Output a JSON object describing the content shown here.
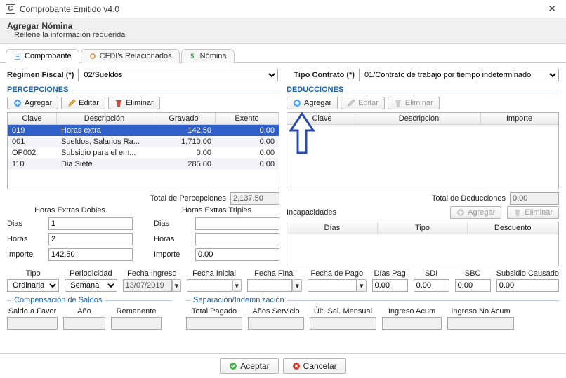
{
  "window": {
    "title": "Comprobante Emitido v4.0"
  },
  "subheader": {
    "title": "Agregar Nómina",
    "subtitle": "Rellene la información requerida"
  },
  "tabs": [
    {
      "label": "Comprobante"
    },
    {
      "label": "CFDI's Relacionados"
    },
    {
      "label": "Nómina"
    }
  ],
  "regimen": {
    "label": "Régimen Fiscal (*)",
    "value": "02/Sueldos"
  },
  "tipocontrato": {
    "label": "Tipo Contrato (*)",
    "value": "01/Contrato de trabajo por tiempo indeterminado"
  },
  "percepciones": {
    "title": "PERCEPCIONES",
    "buttons": {
      "add": "Agregar",
      "edit": "Editar",
      "del": "Eliminar"
    },
    "headers": {
      "clave": "Clave",
      "desc": "Descripción",
      "grav": "Gravado",
      "exen": "Exento"
    },
    "rows": [
      {
        "clave": "019",
        "desc": "Horas extra",
        "grav": "142.50",
        "exen": "0.00",
        "sel": true
      },
      {
        "clave": "001",
        "desc": "Sueldos, Salarios  Ra...",
        "grav": "1,710.00",
        "exen": "0.00"
      },
      {
        "clave": "OP002",
        "desc": "Subsidio para el em...",
        "grav": "0.00",
        "exen": "0.00"
      },
      {
        "clave": "110",
        "desc": "Dia Siete",
        "grav": "285.00",
        "exen": "0.00"
      }
    ],
    "total_label": "Total de Percepciones",
    "total_value": "2,137.50"
  },
  "deducciones": {
    "title": "DEDUCCIONES",
    "buttons": {
      "add": "Agregar",
      "edit": "Editar",
      "del": "Eliminar"
    },
    "headers": {
      "clave": "Clave",
      "desc": "Descripción",
      "imp": "Importe"
    },
    "total_label": "Total de Deducciones",
    "total_value": "0.00"
  },
  "horas_dobles": {
    "title": "Horas Extras Dobles",
    "dias_label": "Dias",
    "dias_value": "1",
    "horas_label": "Horas",
    "horas_value": "2",
    "importe_label": "Importe",
    "importe_value": "142.50"
  },
  "horas_triples": {
    "title": "Horas Extras Triples",
    "dias_label": "Dias",
    "dias_value": "",
    "horas_label": "Horas",
    "horas_value": "",
    "importe_label": "Importe",
    "importe_value": "0.00"
  },
  "incapacidades": {
    "label": "Incapacidades",
    "buttons": {
      "add": "Agregar",
      "del": "Eliminar"
    },
    "headers": {
      "dias": "Días",
      "tipo": "Tipo",
      "desc": "Descuento"
    }
  },
  "meta_fields": {
    "tipo": {
      "label": "Tipo",
      "value": "Ordinaria"
    },
    "periodicidad": {
      "label": "Periodicidad",
      "value": "Semanal"
    },
    "fecha_ingreso": {
      "label": "Fecha Ingreso",
      "value": "13/07/2019"
    },
    "fecha_inicial": {
      "label": "Fecha Inicial",
      "value": ""
    },
    "fecha_final": {
      "label": "Fecha Final",
      "value": ""
    },
    "fecha_pago": {
      "label": "Fecha de Pago",
      "value": ""
    },
    "dias_pag": {
      "label": "Días Pag",
      "value": "0.00"
    },
    "sdi": {
      "label": "SDI",
      "value": "0.00"
    },
    "sbc": {
      "label": "SBC",
      "value": "0.00"
    },
    "subsidio": {
      "label": "Subsidio Causado",
      "value": "0.00"
    }
  },
  "comp_saldos": {
    "title": "Compensación de Saldos",
    "saldo_label": "Saldo a Favor",
    "saldo_value": "",
    "anio_label": "Año",
    "anio_value": "",
    "rem_label": "Remanente",
    "rem_value": ""
  },
  "separacion": {
    "title": "Separación/Indemnización",
    "total_label": "Total Pagado",
    "total_value": "",
    "anios_label": "Años Servicio",
    "anios_value": "",
    "ult_label": "Últ. Sal. Mensual",
    "ult_value": "",
    "acum_label": "Ingreso Acum",
    "acum_value": "",
    "noacum_label": "Ingreso No Acum",
    "noacum_value": ""
  },
  "footer": {
    "ok": "Aceptar",
    "cancel": "Cancelar"
  }
}
